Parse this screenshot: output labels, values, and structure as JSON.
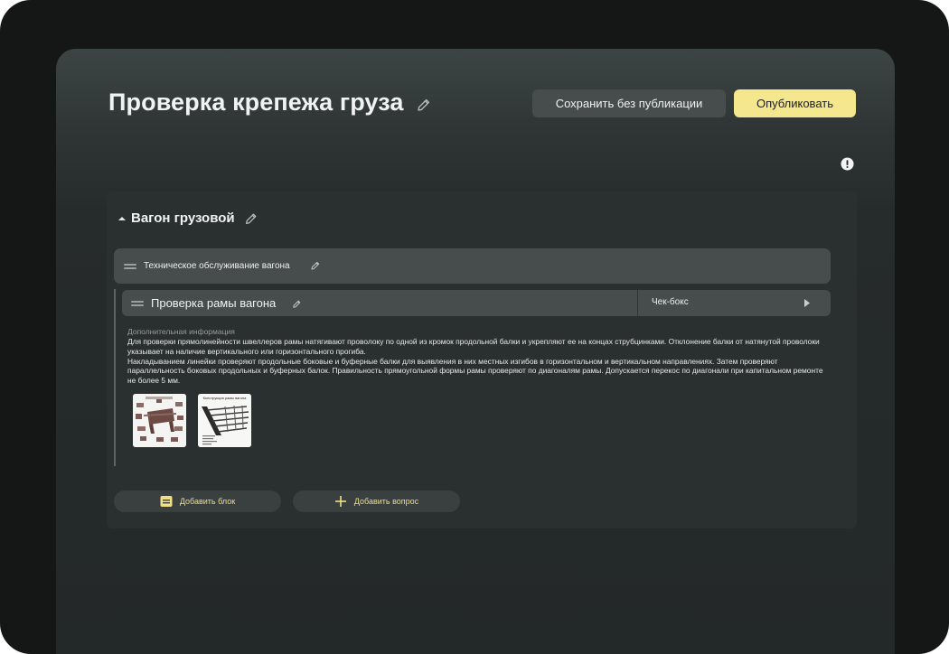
{
  "header": {
    "title": "Проверка крепежа груза",
    "save_label": "Сохранить без публикации",
    "publish_label": "Опубликовать"
  },
  "section": {
    "title": "Вагон грузовой",
    "block": {
      "label": "Техническое обслуживание вагона"
    },
    "question": {
      "label": "Проверка рамы вагона",
      "type": "Чек-бокс",
      "extra_label": "Дополнительная информация",
      "extra_text": "Для проверки прямолинейности швеллеров рамы натягивают проволоку по одной из кромок продольной балки и укрепляют ее на концах струбцинками. Отклонение балки от натянутой проволоки указывает на наличие вертикального или горизонтального прогиба.\nНакладыванием линейки проверяют продольные боковые и буферные балки для выявления в них местных изгибов в горизонтальном и вертикальном направлениях. Затем проверяют параллельность боковых продольных и буферных балок. Правильность прямоугольной формы рамы проверяют по диагоналям рамы. Допускается перекос по диагонали при капитальном ремонте не более 5 мм.",
      "thumb2_caption": "Конструкция рамы вагона"
    },
    "add_block_label": "Добавить блок",
    "add_question_label": "Добавить вопрос"
  },
  "colors": {
    "accent_yellow": "#f4e78d",
    "button_dark": "#474c4d",
    "panel": "#2a2f2f"
  },
  "icons": [
    "pencil-icon",
    "info-icon",
    "drag-handle-icon",
    "caret-up-icon",
    "caret-right-icon",
    "block-icon",
    "plus-icon"
  ]
}
